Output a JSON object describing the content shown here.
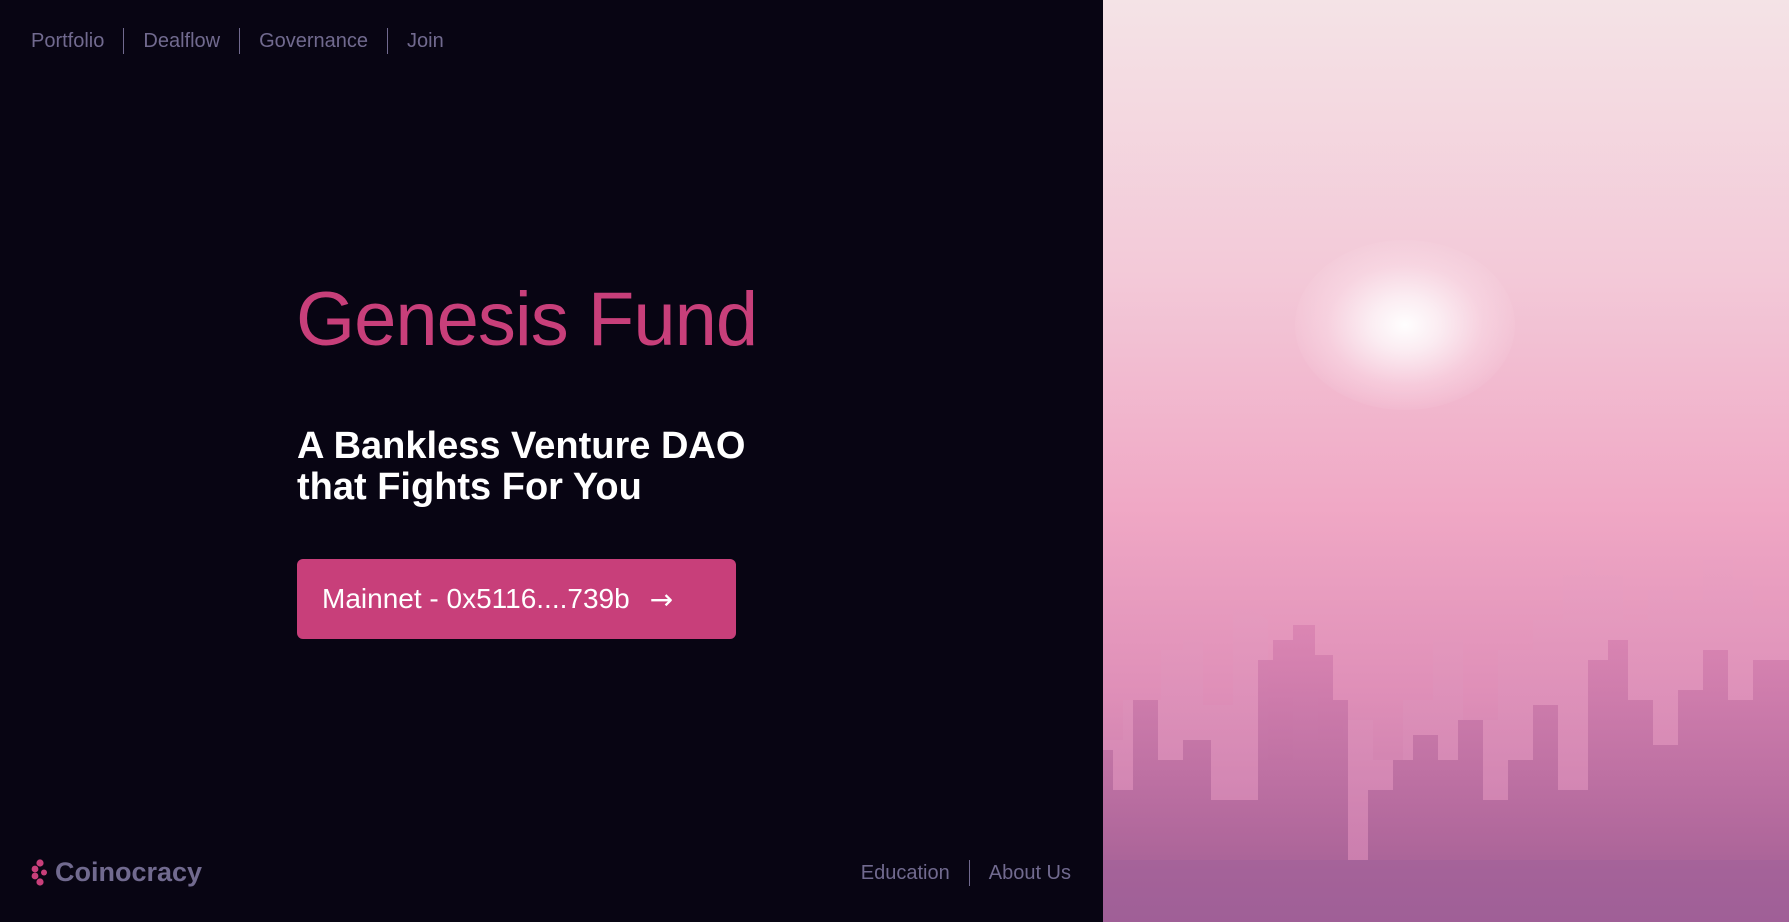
{
  "top_nav": {
    "links": [
      "Portfolio",
      "Dealflow",
      "Governance",
      "Join"
    ]
  },
  "hero": {
    "title": "Genesis Fund",
    "subtitle_line1": "A Bankless Venture DAO",
    "subtitle_line2": "that Fights For You",
    "cta_label": "Mainnet - 0x5116....739b",
    "cta_icon": "arrow-right-icon"
  },
  "footer": {
    "brand_name": "Coinocracy",
    "brand_icon": "coinocracy-logo-icon",
    "links": [
      "Education",
      "About Us"
    ]
  },
  "colors": {
    "background": "#080513",
    "accent": "#c83f7a",
    "nav_text": "#716a8f",
    "hero_text": "#ffffff"
  }
}
